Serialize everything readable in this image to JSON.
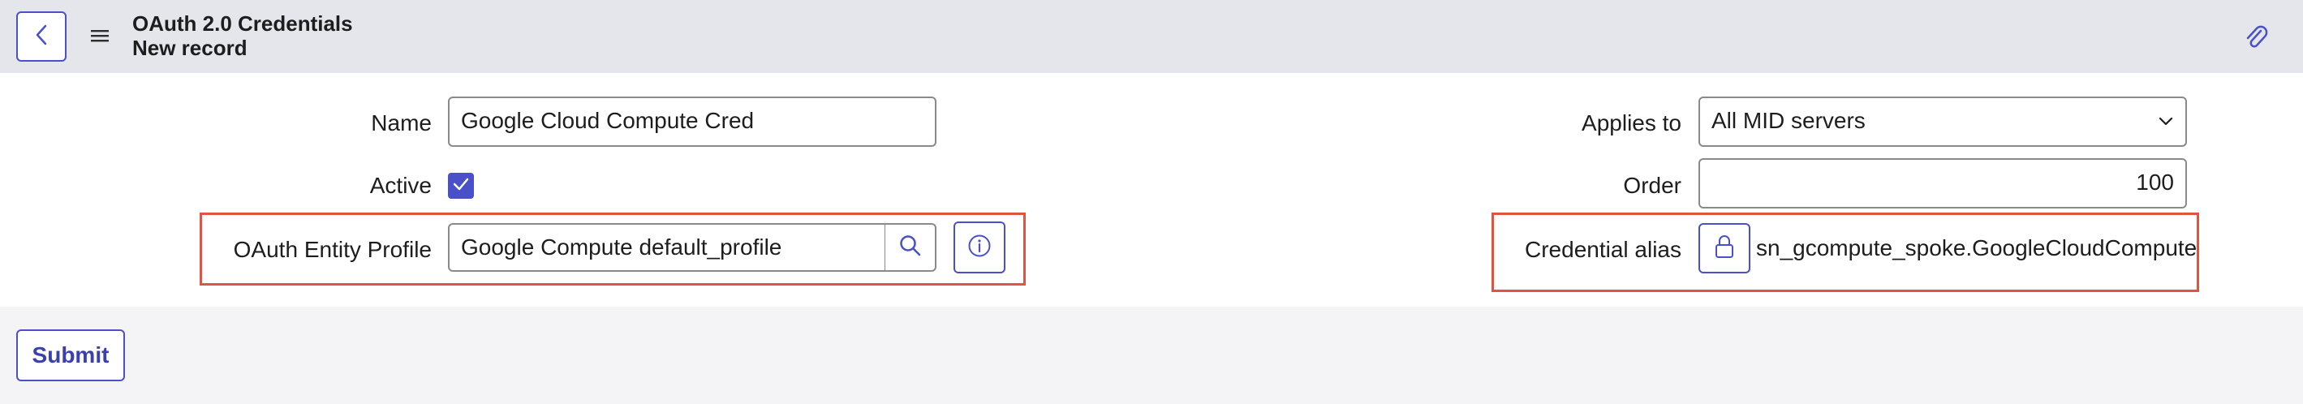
{
  "header": {
    "title": "OAuth 2.0 Credentials",
    "subtitle": "New record"
  },
  "form": {
    "name_label": "Name",
    "name_value": "Google Cloud Compute Cred",
    "active_label": "Active",
    "active_checked": true,
    "oauth_profile_label": "OAuth Entity Profile",
    "oauth_profile_value": "Google Compute default_profile",
    "applies_to_label": "Applies to",
    "applies_to_value": "All MID servers",
    "order_label": "Order",
    "order_value": "100",
    "credential_alias_label": "Credential alias",
    "credential_alias_value": "sn_gcompute_spoke.GoogleCloudCompute"
  },
  "footer": {
    "submit_label": "Submit"
  },
  "colors": {
    "accent": "#4a50c7",
    "highlight": "#e05541",
    "header_bg": "#e5e6ec",
    "page_bg": "#f4f4f6"
  },
  "icons": [
    "back-icon",
    "hamburger-menu-icon",
    "paperclip-icon",
    "checkmark-icon",
    "search-icon",
    "info-icon",
    "lock-icon",
    "chevron-down-icon"
  ]
}
